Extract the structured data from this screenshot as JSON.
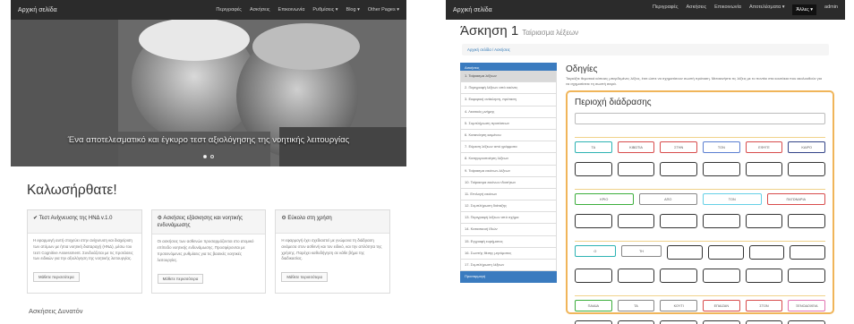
{
  "left": {
    "nav": {
      "brand": "Αρχική σελίδα",
      "items": [
        "Περιγραφές",
        "Ασκήσεις",
        "Επικοινωνία",
        "Ρυθμίσεις ▾",
        "Blog ▾",
        "Other Pages ▾"
      ]
    },
    "hero": {
      "caption": "Ένα αποτελεσματικό και έγκυρο τεστ αξιολόγησης της νοητικής λειτουργίας",
      "slides_total": 2,
      "active_slide": 1
    },
    "welcome_title": "Καλωσήρθατε!",
    "panels": [
      {
        "title": "✔ Τεστ Ανίχνευσης της ΗΝΔ v.1.0",
        "body": "Η εφαρμογή αυτή στοχεύει στην ανίχνευση και διαχείριση των ατόμων με ήπια νοητική διαταραχή (ΗΝΔ), μέσω του τεστ Cognitive Assessment. Συνδυάζεται με τις προτάσεις των ειδικών για την αξιολόγηση της νοητικής λειτουργίας.",
        "button": "Μάθετε περισσότερα"
      },
      {
        "title": "⚙ Ασκήσεις εξάσκησης και νοητικής ενδυνάμωσης",
        "body": "Οι ασκήσεις των ασθενών προσαρμόζονται στο ατομικό επίπεδο νοητικής ενδυνάμωσης. Προσφέρονται με προτεινόμενες ρυθμίσεις για τις βασικές νοητικές λειτουργίες.",
        "button": "Μάθετε περισσότερα"
      },
      {
        "title": "⚙ Εύκολο στη χρήση",
        "body": "Η εφαρμογή έχει σχεδιαστεί με γνώμονα τη διάδραση ανάμεσα στον ασθενή και τον ειδικό, και την απλότητα της χρήσης. Παρέχει καθοδήγηση σε κάθε βήμα της διαδικασίας.",
        "button": "Μάθετε περισσότερα"
      }
    ],
    "bottom_title": "Ασκήσεις Δυνατόν"
  },
  "right": {
    "nav": {
      "brand": "Αρχική σελίδα",
      "items": [
        "Περιγραφές",
        "Ασκήσεις",
        "Επικοινωνία",
        "Αποτελέσματα ▾",
        "Άλλες ▾",
        "admin"
      ],
      "active_index": 4
    },
    "title": "Άσκηση 1",
    "subtitle": "Ταίριασμα λέξεων",
    "breadcrumb": "Αρχική σελίδα / Ασκήσεις",
    "sidebar": {
      "header": "Ασκήσεις",
      "items": [
        "1. Ταίριασμα λέξεων",
        "2. Περιγραφή λέξεων από εικόνες",
        "3. Εκφορική ανάκληση, πρόταση",
        "4. Λεκτικός μνήμης",
        "5. Συμπλήρωση προτάσεων",
        "6. Κατανόηση κειμένου",
        "7. Εύρεση λέξεων από γράμματα",
        "8. Κατηγοριοποίηση λέξεων",
        "9. Ταίριασμα εικόνων-λέξεων",
        "10. Ταίριασμα εικόνων ιδιοτήτων",
        "11. Επιλογή εικόνων",
        "12. Συμπλήρωση διάταξης",
        "13. Περιγραφή λέξεων από σχήμα",
        "14. Κατασκευή Ιδιών",
        "15. Εγγραφή ευρήματος",
        "16. Σωστής θέσης μηνύματος",
        "17. Συμπλήρωση λέξεων"
      ],
      "active_index": 0,
      "footer": "Προσαρμογή"
    },
    "instructions_title": "Οδηγίες",
    "instructions_text": "Ταιριάξτε θεματικά κάποιες μπερδεμένες λέξεις, έτσι ώστε να σχηματίσουν σωστή πρόταση. Μετακινήστε τις λέξεις με το ποντίκι στα κουτάκια που ακολουθούν για να σχηματίσετε τη σωστή σειρά.",
    "area_title": "Περιοχή διάδρασης",
    "rows": [
      {
        "chips": [
          {
            "t": "ΤΑ",
            "c": "c-teal"
          },
          {
            "t": "ΚΙΒΩΤΙΑ",
            "c": "c-red"
          },
          {
            "t": "ΣΤΗΝ",
            "c": "c-red"
          },
          {
            "t": "ΤΟΝ",
            "c": "c-blue"
          },
          {
            "t": "ΕΦΥΓΕ",
            "c": "c-red"
          },
          {
            "t": "ΚΑΙΡΟ",
            "c": "c-navy"
          }
        ],
        "slots": 0
      },
      {
        "chips": [
          {
            "t": "ΚΡΙΟ",
            "c": "c-green"
          },
          {
            "t": "ΑΠΟ",
            "c": "c-gray"
          },
          {
            "t": "ΤΟΝ",
            "c": "c-cyan"
          },
          {
            "t": "ΠΑΓΩΝΑΡΙΑ",
            "c": "c-red"
          }
        ],
        "slots": 0
      },
      {
        "chips": [
          {
            "t": "Ο",
            "c": "c-teal"
          },
          {
            "t": "ΤΗ",
            "c": "c-gray"
          }
        ],
        "slots": 4
      },
      {
        "chips": [
          {
            "t": "ΠΑΙΔΙΑ",
            "c": "c-green"
          },
          {
            "t": "ΤΑ",
            "c": "c-gray"
          },
          {
            "t": "ΚΟΥΤΙ",
            "c": "c-gray"
          },
          {
            "t": "ΕΠΑΙΖΑΝ",
            "c": "c-red"
          },
          {
            "t": "ΣΤΟΝ",
            "c": "c-red"
          },
          {
            "t": "ΞΕΝΟΔΟΧΕΙΑ",
            "c": "c-pink"
          }
        ],
        "slots": 0
      }
    ]
  }
}
